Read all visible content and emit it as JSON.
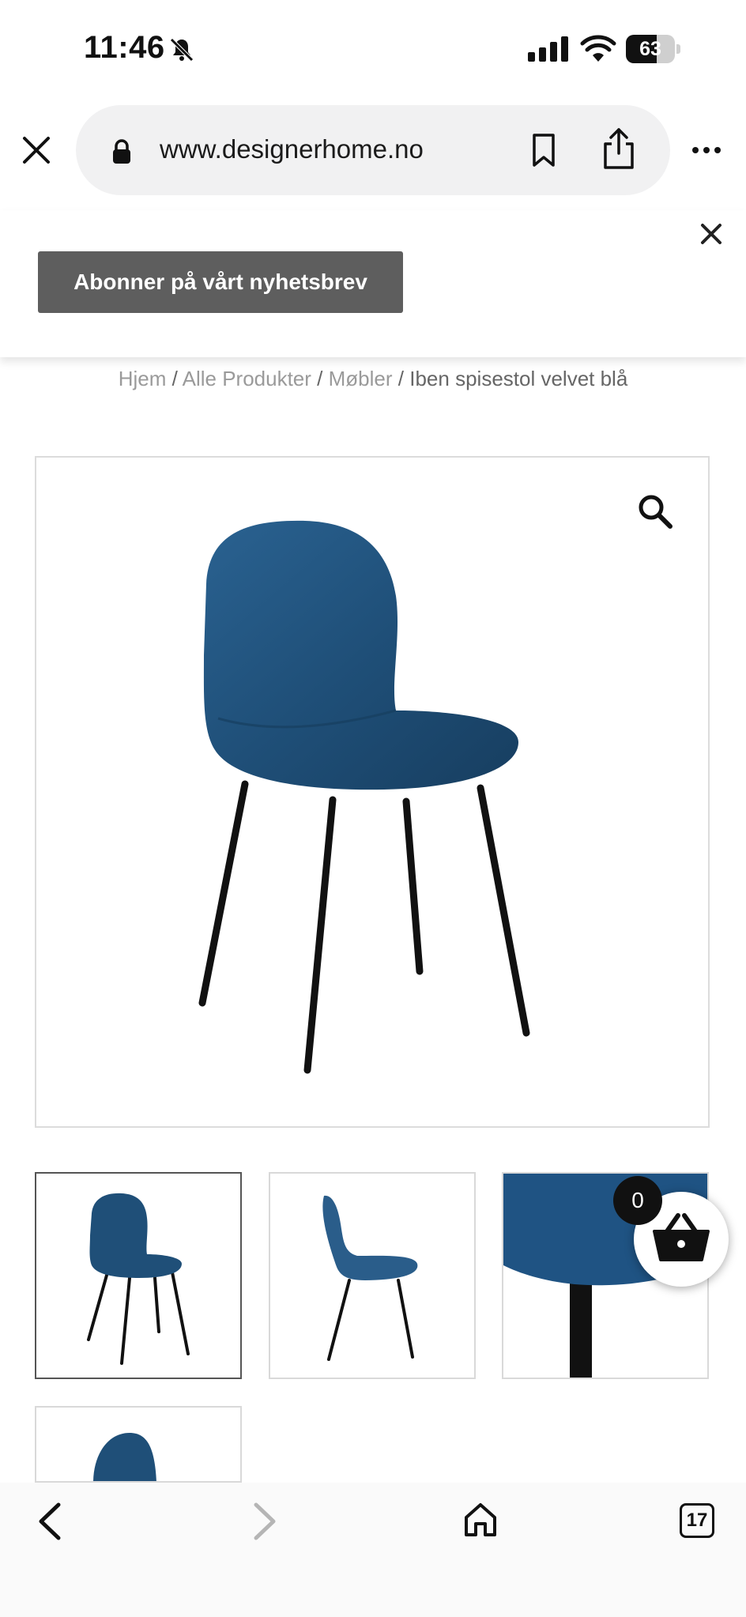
{
  "status_bar": {
    "time": "11:46",
    "battery_percent": "63",
    "battery_level": 0.63
  },
  "browser": {
    "url": "www.designerhome.no",
    "icons": [
      "close-icon",
      "lock-icon",
      "bookmark-icon",
      "share-icon",
      "more-icon"
    ]
  },
  "newsletter": {
    "button_label": "Abonner på vårt nyhetsbrev"
  },
  "breadcrumb": {
    "items": [
      "Hjem",
      "Alle Produkter",
      "Møbler"
    ],
    "current": "Iben spisestol velvet blå",
    "separator": "/"
  },
  "product": {
    "velvet_color": "#1f4f78",
    "leg_color": "#111111"
  },
  "cart": {
    "count": "0"
  },
  "toolbar": {
    "tabs_count": "17"
  }
}
